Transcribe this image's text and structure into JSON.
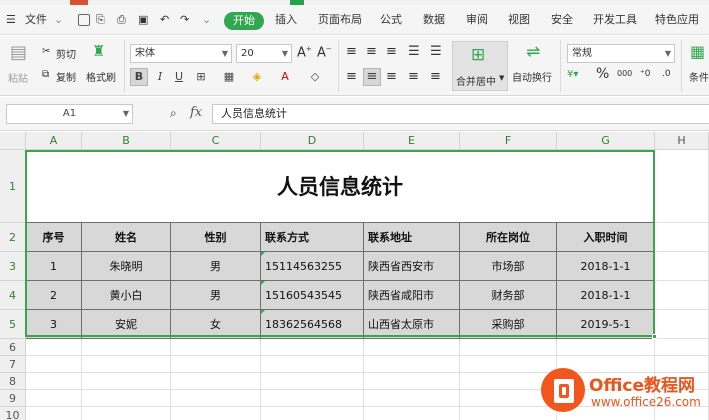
{
  "menubar": {
    "file_label": "文件",
    "tabs": [
      "开始",
      "插入",
      "页面布局",
      "公式",
      "数据",
      "审阅",
      "视图",
      "安全",
      "开发工具",
      "特色应用"
    ]
  },
  "ribbon": {
    "paste_label": "粘贴",
    "cut_label": "剪切",
    "copy_label": "复制",
    "format_painter_label": "格式刷",
    "font_name": "宋体",
    "font_size": "20",
    "bold": "B",
    "italic": "I",
    "underline": "U",
    "merge_center_label": "合并居中",
    "wrap_text_label": "自动换行",
    "number_format": "常规",
    "percent": "%",
    "thousands": "000",
    "conditional_label": "条件"
  },
  "formula_bar": {
    "cell_ref": "A1",
    "fx_label": "fx",
    "content": "人员信息统计"
  },
  "sheet": {
    "columns": [
      "A",
      "B",
      "C",
      "D",
      "E",
      "F",
      "G",
      "H"
    ],
    "rows": [
      "1",
      "2",
      "3",
      "4",
      "5",
      "6",
      "7",
      "8",
      "9",
      "10"
    ],
    "table_title": "人员信息统计",
    "headers": [
      "序号",
      "姓名",
      "性别",
      "联系方式",
      "联系地址",
      "所在岗位",
      "入职时间"
    ],
    "records": [
      [
        "1",
        "朱晓明",
        "男",
        "15114563255",
        "陕西省西安市",
        "市场部",
        "2018-1-1"
      ],
      [
        "2",
        "黄小白",
        "男",
        "15160543545",
        "陕西省咸阳市",
        "财务部",
        "2018-1-1"
      ],
      [
        "3",
        "安妮",
        "女",
        "18362564568",
        "山西省太原市",
        "采购部",
        "2019-5-1"
      ]
    ]
  },
  "watermark": {
    "title": "Office教程网",
    "url": "www.office26.com"
  },
  "colors": {
    "accent": "#2fa84f",
    "selection": "#3aa64a",
    "table_fill": "#d8d8d8",
    "watermark": "#e8561d"
  }
}
